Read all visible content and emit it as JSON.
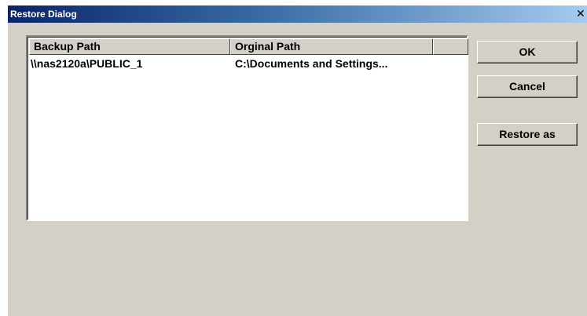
{
  "window": {
    "title": "Restore Dialog",
    "close_glyph": "✕"
  },
  "list": {
    "columns": [
      "Backup Path",
      "Orginal Path",
      ""
    ],
    "rows": [
      {
        "backup_path": "\\\\nas2120a\\PUBLIC_1",
        "original_path": "C:\\Documents and Settings..."
      }
    ]
  },
  "buttons": {
    "ok": "OK",
    "cancel": "Cancel",
    "restore_as": "Restore as"
  }
}
